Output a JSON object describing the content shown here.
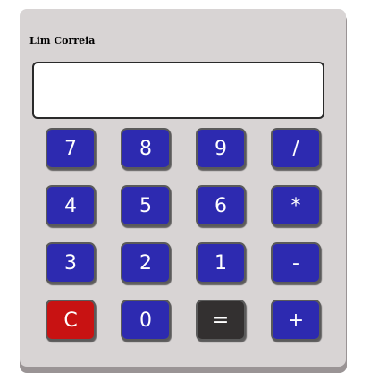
{
  "calculator": {
    "title": "Lim Correia",
    "display_value": "",
    "keys": {
      "k7": "7",
      "k8": "8",
      "k9": "9",
      "divide": "/",
      "k4": "4",
      "k5": "5",
      "k6": "6",
      "multiply": "*",
      "k3": "3",
      "k2": "2",
      "k1": "1",
      "subtract": "-",
      "clear": "C",
      "k0": "0",
      "equals": "=",
      "add": "+"
    }
  },
  "colors": {
    "body": "#d8d4d4",
    "key": "#2d2ab0",
    "clear_key": "#c81212",
    "equals_key": "#333030"
  }
}
